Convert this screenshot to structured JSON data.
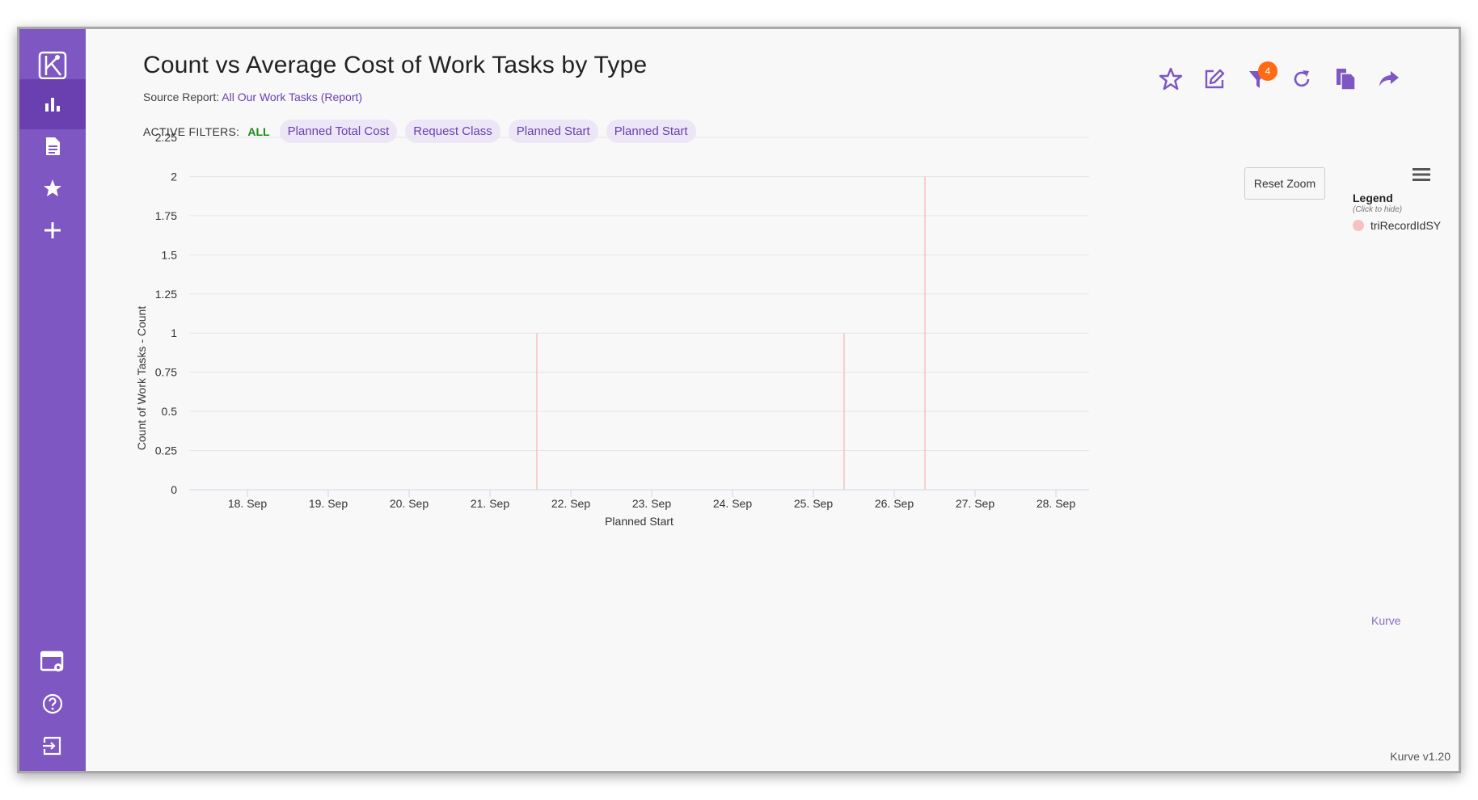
{
  "header": {
    "title": "Count vs Average Cost of Work Tasks by Type",
    "source_label": "Source Report:",
    "source_link": "All Our Work Tasks (Report)"
  },
  "toolbar": {
    "filter_badge": "4",
    "icons": [
      "star-icon",
      "edit-icon",
      "filter-icon",
      "refresh-icon",
      "copy-icon",
      "share-icon"
    ]
  },
  "filters": {
    "label": "ACTIVE FILTERS:",
    "mode": "ALL",
    "chips": [
      "Planned Total Cost",
      "Request Class",
      "Planned Start",
      "Planned Start"
    ]
  },
  "sidebar": {
    "items": [
      "logo-icon",
      "chart-icon",
      "document-icon",
      "star-icon",
      "plus-icon",
      "settings-panel-icon",
      "help-icon",
      "logout-icon"
    ],
    "active": "chart-icon"
  },
  "chart": {
    "reset_zoom": "Reset Zoom",
    "legend_title": "Legend",
    "legend_hint": "(Click to hide)",
    "credit": "Kurve"
  },
  "chart_data": {
    "type": "bar",
    "xlabel": "Planned Start",
    "ylabel": "Count of Work Tasks - Count",
    "ylim": [
      0,
      2.25
    ],
    "yticks": [
      "0",
      "0.25",
      "0.5",
      "0.75",
      "1",
      "1.25",
      "1.5",
      "1.75",
      "2",
      "2.25"
    ],
    "xticks": [
      "18. Sep",
      "19. Sep",
      "20. Sep",
      "21. Sep",
      "22. Sep",
      "23. Sep",
      "24. Sep",
      "25. Sep",
      "26. Sep",
      "27. Sep",
      "28. Sep"
    ],
    "grid": true,
    "legend_position": "right",
    "series": [
      {
        "name": "triRecordIdSY",
        "color": "#f7c1c1",
        "points": [
          {
            "x": "21. Sep",
            "offset_days": 0.58,
            "y": 1
          },
          {
            "x": "25. Sep",
            "offset_days": 0.38,
            "y": 1
          },
          {
            "x": "26. Sep",
            "offset_days": 0.38,
            "y": 2
          }
        ]
      }
    ]
  },
  "footer": {
    "version": "Kurve v1.20"
  }
}
